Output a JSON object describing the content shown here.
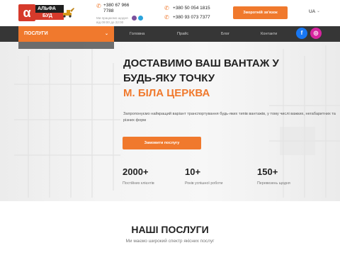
{
  "header": {
    "logo": {
      "name": "АЛЬФА",
      "sub": "БУД"
    },
    "phones_left": [
      "+380 67 966 7788"
    ],
    "hours": "Ми працюємо щодня від 09:00 до 22:00",
    "phones_right": [
      "+380 50 054 1815",
      "+380 93 073 7377"
    ],
    "callback_label": "Зворотній зв'язок",
    "language": "UA"
  },
  "nav": {
    "services_label": "ПОСЛУГИ",
    "items": [
      "Головна",
      "Прайс",
      "Блог",
      "Контакти"
    ],
    "social": [
      {
        "icon": "facebook-icon",
        "color": "#1877f2",
        "glyph": "f"
      },
      {
        "icon": "instagram-icon",
        "color": "#d6249f",
        "glyph": "◎"
      }
    ]
  },
  "hero": {
    "title_line1": "ДОСТАВИМО ВАШ ВАНТАЖ У",
    "title_line2": "БУДЬ-ЯКУ ТОЧКУ",
    "city": "М. БІЛА ЦЕРКВА",
    "description": "Запропонуємо найкращий варіант транспортування будь-яких типів вантажів, у тому числі важких, негабаритних та різних форм",
    "order_label": "Замовити послугу",
    "stats": [
      {
        "value": "2000+",
        "label": "Постійних клієнтів"
      },
      {
        "value": "10+",
        "label": "Років успішної роботи"
      },
      {
        "value": "150+",
        "label": "Перевезень щодня"
      }
    ]
  },
  "services": {
    "title": "НАШІ ПОСЛУГИ",
    "subtitle": "Ми маємо широкий спектр якісних послуг"
  },
  "colors": {
    "accent": "#f0792d",
    "nav_bg": "#363636",
    "brand_red": "#d63a2b"
  }
}
